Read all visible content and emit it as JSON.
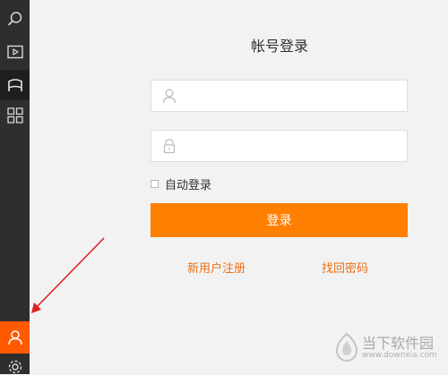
{
  "sidebar": {
    "items": [
      {
        "icon": "search-icon"
      },
      {
        "icon": "video-play-icon"
      },
      {
        "icon": "bookmark-icon"
      },
      {
        "icon": "grid-icon"
      },
      {
        "icon": "user-icon"
      },
      {
        "icon": "gear-icon"
      }
    ],
    "accent_color": "#ff5a00"
  },
  "login": {
    "title": "帐号登录",
    "username": {
      "value": "",
      "placeholder": "",
      "icon": "user-icon"
    },
    "password": {
      "value": "",
      "placeholder": "",
      "icon": "lock-icon"
    },
    "remember_label": "自动登录",
    "remember_checked": false,
    "submit_label": "登录",
    "submit_color": "#ff7f00",
    "register_link": "新用户注册",
    "forgot_link": "找回密码",
    "link_color": "#e8711a"
  },
  "annotation": {
    "icon": "red-arrow-icon",
    "color": "#e02020"
  },
  "watermark": {
    "name": "当下软件园",
    "url": "www.downxia.com",
    "icon": "downxia-logo-icon"
  }
}
